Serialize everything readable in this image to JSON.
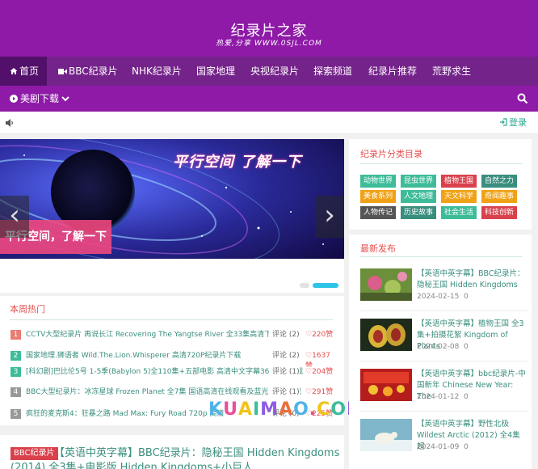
{
  "site": {
    "title": "纪录片之家",
    "subtitle": "热爱,分享   WWW.0SJL.COM"
  },
  "nav": {
    "items": [
      {
        "label": "首页"
      },
      {
        "label": "BBC纪录片"
      },
      {
        "label": "NHK纪录片"
      },
      {
        "label": "国家地理"
      },
      {
        "label": "央视纪录片"
      },
      {
        "label": "探索频道"
      },
      {
        "label": "纪录片推荐"
      },
      {
        "label": "荒野求生"
      }
    ],
    "sub_label": "美剧下载"
  },
  "notice": {
    "login_label": "登录"
  },
  "slider": {
    "caption": "平行空间，了解一下",
    "banner_text": "平行空间 了解一下"
  },
  "hot": {
    "title": "本周热门",
    "items": [
      {
        "rank": "1",
        "text": "CCTV大型纪录片 再说长江 Recovering The Yangtse River 全33集高清下载",
        "comments": "评论 (2)",
        "likes": "220赞"
      },
      {
        "rank": "2",
        "text": "国家地理.狮语者 Wild.The.Lion.Whisperer 高清720P纪录片下载",
        "comments": "评论 (2)",
        "likes": "1637赞"
      },
      {
        "rank": "3",
        "text": "[科幻剧]巴比伦5号 1-5季(Babylon 5)全110集+五部电影 高清中文字幕360云盘下载",
        "comments": "评论 (1)",
        "likes": "204赞"
      },
      {
        "rank": "4",
        "text": "BBC大型纪录片：冰冻星球 Frozen Planet 全7集 国语高清在线观看及蓝光720P下载",
        "comments": "评论 (1)",
        "likes": "291赞"
      },
      {
        "rank": "5",
        "text": "疯狂的麦克斯4：狂暴之路 Mad Max: Fury Road 720p 高清",
        "comments": "评论 (0)",
        "likes": "225赞"
      }
    ]
  },
  "watermark": "KUAIMAO.COM",
  "post": {
    "category": "BBC纪录片",
    "title": "【英语中英字幕】BBC纪录片：隐秘王国 Hidden Kingdoms (2014) 全3集+电影版 Hidden Kingdoms+小巨人"
  },
  "categories": {
    "title": "纪录片分类目录",
    "tags": [
      {
        "label": "动物世界",
        "color": "#3ebc9a"
      },
      {
        "label": "昆虫世界",
        "color": "#3ebc9a"
      },
      {
        "label": "植物王国",
        "color": "#d9414c"
      },
      {
        "label": "自然之力",
        "color": "#3a8e7e"
      },
      {
        "label": "美食系列",
        "color": "#f0a216"
      },
      {
        "label": "人文地理",
        "color": "#3ebc9a"
      },
      {
        "label": "天文科学",
        "color": "#f0a216"
      },
      {
        "label": "奇闻趣事",
        "color": "#f0a216"
      },
      {
        "label": "人物传记",
        "color": "#555555"
      },
      {
        "label": "历史故事",
        "color": "#3a8e7e"
      },
      {
        "label": "社会生活",
        "color": "#3ebc9a"
      },
      {
        "label": "科技创新",
        "color": "#d9414c"
      }
    ]
  },
  "latest": {
    "title": "最新发布",
    "items": [
      {
        "title": "【英语中英字幕】BBC纪录片：隐秘王国 Hidden Kingdoms",
        "date": "2024-02-15",
        "count": "0"
      },
      {
        "title": "【英语中英字幕】植物王国 全3集+拍摄花絮 Kingdom of Plants",
        "date": "2024-02-08",
        "count": "0"
      },
      {
        "title": "【英语中英字幕】bbc纪录片-中国新年 Chinese New Year: The",
        "date": "2024-01-12",
        "count": "0"
      },
      {
        "title": "【英语中英字幕】野性北极 Wildest Arctic (2012) 全4集 超",
        "date": "2024-01-09",
        "count": "0"
      }
    ]
  },
  "colors": {
    "header": "#8e1aa7",
    "nav": "#74238a",
    "accent": "#3a8e7e",
    "hot": "#e4504f"
  }
}
